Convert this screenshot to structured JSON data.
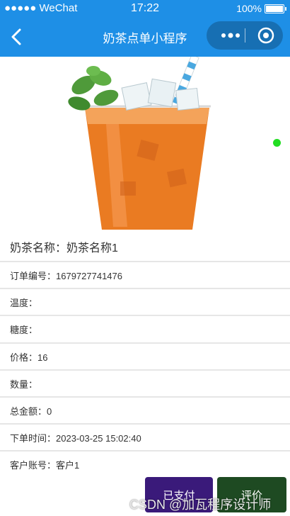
{
  "statusbar": {
    "carrier": "●●●●● WeChat",
    "time": "17:22",
    "battery": "100%"
  },
  "navbar": {
    "title": "奶茶点单小程序"
  },
  "product": {
    "name_label": "奶茶名称：奶茶名称1"
  },
  "fields": [
    {
      "text": "订单编号：1679727741476"
    },
    {
      "text": "温度："
    },
    {
      "text": "糖度："
    },
    {
      "text": "价格：16"
    },
    {
      "text": "数量："
    },
    {
      "text": "总金额：0"
    },
    {
      "text": "下单时间：2023-03-25 15:02:40"
    },
    {
      "text": "客户账号：客户1"
    }
  ],
  "buttons": {
    "paid": "已支付",
    "review": "评价"
  },
  "watermark": "CSDN @加瓦程序设计师",
  "colors": {
    "nav": "#1e8fe6",
    "paid": "#3a1a7a",
    "review": "#1e4a22",
    "indicator": "#22dd22"
  }
}
